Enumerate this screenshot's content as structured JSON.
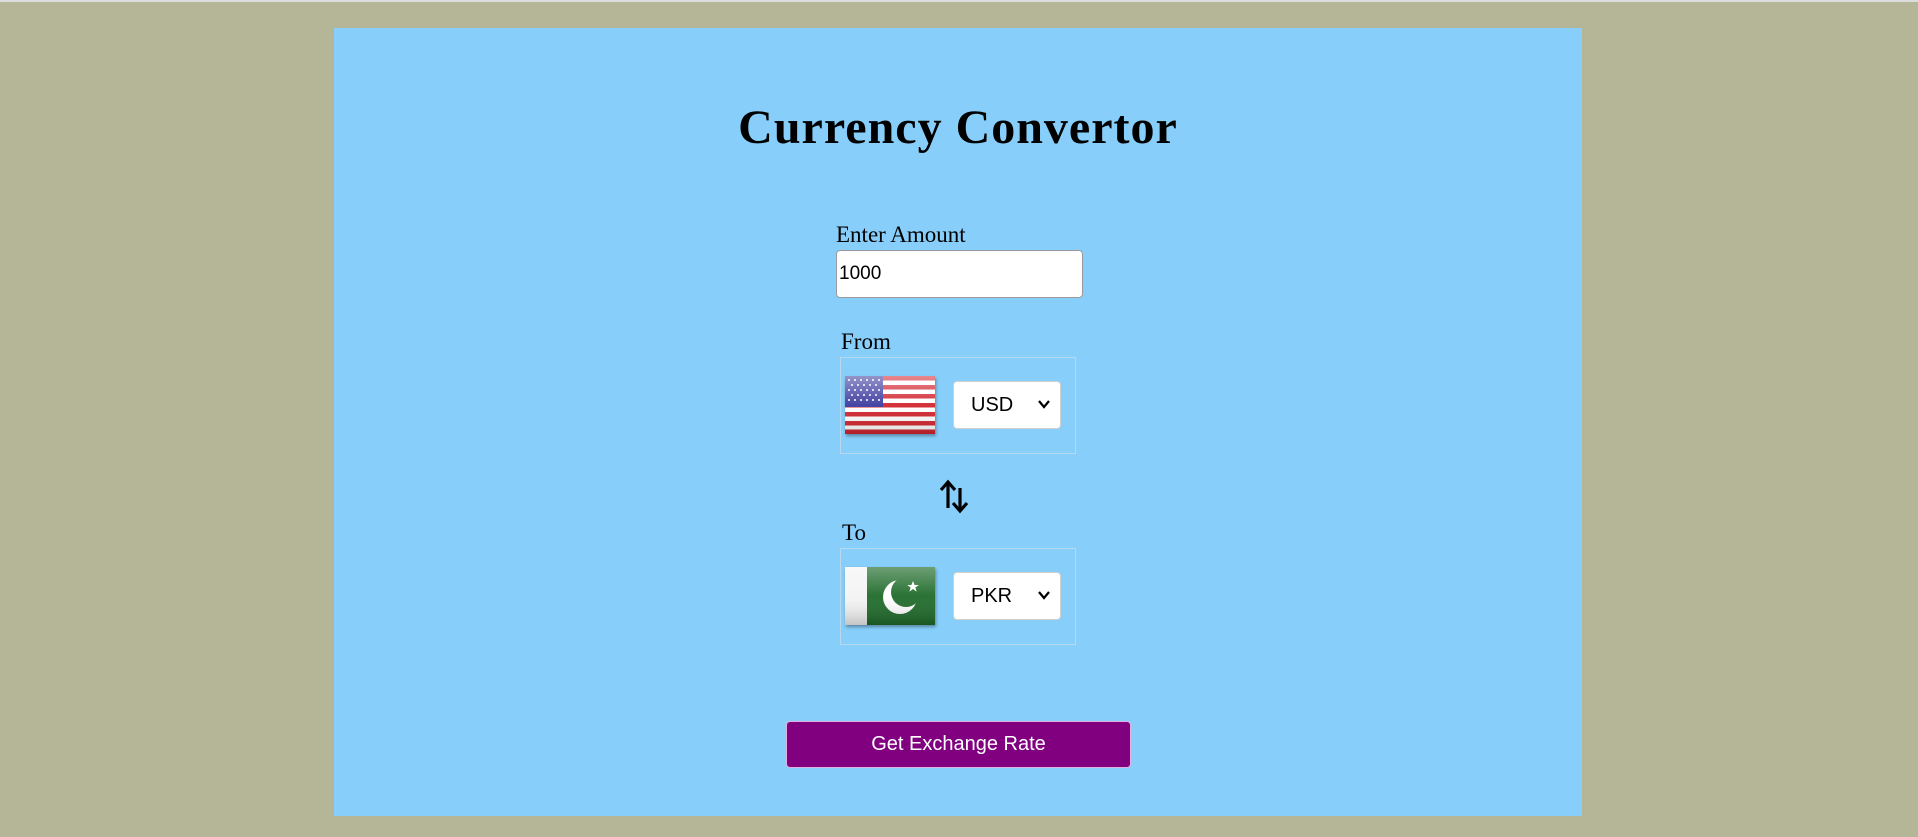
{
  "app": {
    "title": "Currency Convertor"
  },
  "amount": {
    "label": "Enter Amount",
    "value": "1000"
  },
  "from": {
    "label": "From",
    "currency": "USD",
    "flag_icon": "us-flag-icon"
  },
  "to": {
    "label": "To",
    "currency": "PKR",
    "flag_icon": "pk-flag-icon"
  },
  "swap": {
    "icon": "swap-arrows-icon"
  },
  "button": {
    "label": "Get Exchange Rate"
  },
  "colors": {
    "page_background": "#b5b597",
    "card_background": "#87cefa",
    "button_background": "#800080",
    "button_text": "#ffffff"
  }
}
